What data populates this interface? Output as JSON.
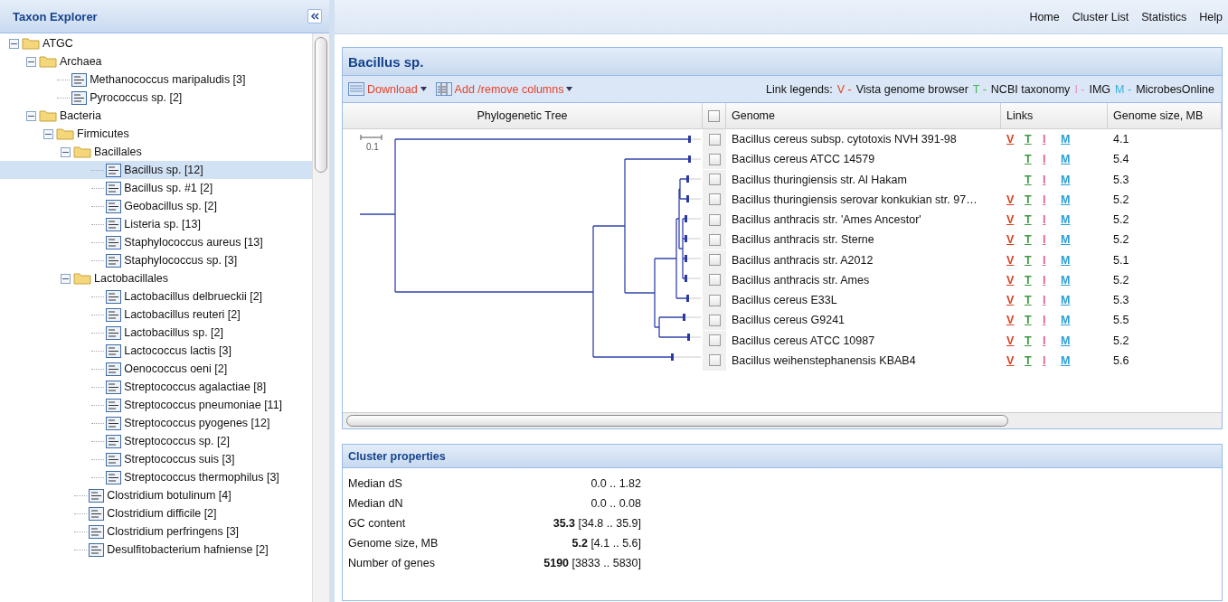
{
  "taxon_explorer": {
    "title": "Taxon Explorer",
    "tree": [
      {
        "kind": "folder",
        "label": "ATGC",
        "expanded": true,
        "selected": false,
        "children": [
          {
            "kind": "folder",
            "label": "Archaea",
            "expanded": true,
            "selected": false,
            "children": [
              {
                "kind": "leaf",
                "label": "Methanococcus maripaludis [3]",
                "selected": false
              },
              {
                "kind": "leaf",
                "label": "Pyrococcus sp. [2]",
                "selected": false
              }
            ]
          },
          {
            "kind": "folder",
            "label": "Bacteria",
            "expanded": true,
            "selected": false,
            "children": [
              {
                "kind": "folder",
                "label": "Firmicutes",
                "expanded": true,
                "selected": false,
                "children": [
                  {
                    "kind": "folder",
                    "label": "Bacillales",
                    "expanded": true,
                    "selected": false,
                    "children": [
                      {
                        "kind": "leaf",
                        "label": "Bacillus sp. [12]",
                        "selected": true
                      },
                      {
                        "kind": "leaf",
                        "label": "Bacillus sp. #1 [2]",
                        "selected": false
                      },
                      {
                        "kind": "leaf",
                        "label": "Geobacillus sp. [2]",
                        "selected": false
                      },
                      {
                        "kind": "leaf",
                        "label": "Listeria sp. [13]",
                        "selected": false
                      },
                      {
                        "kind": "leaf",
                        "label": "Staphylococcus aureus [13]",
                        "selected": false
                      },
                      {
                        "kind": "leaf",
                        "label": "Staphylococcus sp. [3]",
                        "selected": false
                      }
                    ]
                  },
                  {
                    "kind": "folder",
                    "label": "Lactobacillales",
                    "expanded": true,
                    "selected": false,
                    "children": [
                      {
                        "kind": "leaf",
                        "label": "Lactobacillus delbrueckii [2]",
                        "selected": false
                      },
                      {
                        "kind": "leaf",
                        "label": "Lactobacillus reuteri [2]",
                        "selected": false
                      },
                      {
                        "kind": "leaf",
                        "label": "Lactobacillus sp. [2]",
                        "selected": false
                      },
                      {
                        "kind": "leaf",
                        "label": "Lactococcus lactis [3]",
                        "selected": false
                      },
                      {
                        "kind": "leaf",
                        "label": "Oenococcus oeni [2]",
                        "selected": false
                      },
                      {
                        "kind": "leaf",
                        "label": "Streptococcus agalactiae [8]",
                        "selected": false
                      },
                      {
                        "kind": "leaf",
                        "label": "Streptococcus pneumoniae [11]",
                        "selected": false
                      },
                      {
                        "kind": "leaf",
                        "label": "Streptococcus pyogenes [12]",
                        "selected": false
                      },
                      {
                        "kind": "leaf",
                        "label": "Streptococcus sp. [2]",
                        "selected": false
                      },
                      {
                        "kind": "leaf",
                        "label": "Streptococcus suis [3]",
                        "selected": false
                      },
                      {
                        "kind": "leaf",
                        "label": "Streptococcus thermophilus [3]",
                        "selected": false
                      }
                    ]
                  },
                  {
                    "kind": "leaf",
                    "label": "Clostridium botulinum [4]",
                    "selected": false
                  },
                  {
                    "kind": "leaf",
                    "label": "Clostridium difficile [2]",
                    "selected": false
                  },
                  {
                    "kind": "leaf",
                    "label": "Clostridium perfringens [3]",
                    "selected": false
                  },
                  {
                    "kind": "leaf",
                    "label": "Desulfitobacterium hafniense [2]",
                    "selected": false
                  }
                ]
              }
            ]
          }
        ]
      }
    ]
  },
  "nav": [
    "Home",
    "Cluster List",
    "Statistics",
    "Help"
  ],
  "cluster": {
    "title": "Bacillus sp.",
    "toolbar": [
      {
        "kind": "download",
        "label": "Download"
      },
      {
        "kind": "columns",
        "label": "Add /remove columns"
      }
    ],
    "legend_label": "Link legends:",
    "legend": [
      {
        "label": "V -",
        "description": "Vista genome browser",
        "color": "#e0421e"
      },
      {
        "label": "T -",
        "description": "NCBI taxonomy",
        "color": "#45b653"
      },
      {
        "label": "I -",
        "description": "IMG",
        "color": "#e68fb8"
      },
      {
        "label": "M -",
        "description": "MicrobesOnline",
        "color": "#35b0dc"
      }
    ],
    "tree_column": "Phylogenetic Tree",
    "scale_label": "0.1",
    "header_checked": false,
    "columns": [
      "Genome",
      "Links",
      "Genome size, MB"
    ],
    "rows": [
      {
        "genome": "Bacillus cereus subsp. cytotoxis NVH 391-98",
        "checked": false,
        "size": "4.1",
        "links": [
          {
            "kind": "v",
            "label": "V",
            "color": "#d9401e"
          },
          {
            "kind": "t",
            "label": "T",
            "color": "#3a9a3f"
          },
          {
            "kind": "i",
            "label": "I",
            "color": "#e0609a"
          },
          {
            "kind": "m",
            "label": "M",
            "color": "#2a9fd6"
          }
        ]
      },
      {
        "genome": "Bacillus cereus ATCC 14579",
        "checked": false,
        "size": "5.4",
        "links": [
          {
            "kind": "t",
            "label": "T",
            "color": "#3a9a3f"
          },
          {
            "kind": "i",
            "label": "I",
            "color": "#e0609a"
          },
          {
            "kind": "m",
            "label": "M",
            "color": "#2a9fd6"
          }
        ]
      },
      {
        "genome": "Bacillus thuringiensis str. Al Hakam",
        "checked": false,
        "size": "5.3",
        "links": [
          {
            "kind": "t",
            "label": "T",
            "color": "#3a9a3f"
          },
          {
            "kind": "i",
            "label": "I",
            "color": "#e0609a"
          },
          {
            "kind": "m",
            "label": "M",
            "color": "#2a9fd6"
          }
        ]
      },
      {
        "genome": "Bacillus thuringiensis serovar konkukian str. 97…",
        "checked": false,
        "size": "5.2",
        "links": [
          {
            "kind": "v",
            "label": "V",
            "color": "#d9401e"
          },
          {
            "kind": "t",
            "label": "T",
            "color": "#3a9a3f"
          },
          {
            "kind": "i",
            "label": "I",
            "color": "#e0609a"
          },
          {
            "kind": "m",
            "label": "M",
            "color": "#2a9fd6"
          }
        ]
      },
      {
        "genome": "Bacillus anthracis str. 'Ames Ancestor'",
        "checked": false,
        "size": "5.2",
        "links": [
          {
            "kind": "v",
            "label": "V",
            "color": "#d9401e"
          },
          {
            "kind": "t",
            "label": "T",
            "color": "#3a9a3f"
          },
          {
            "kind": "i",
            "label": "I",
            "color": "#e0609a"
          },
          {
            "kind": "m",
            "label": "M",
            "color": "#2a9fd6"
          }
        ]
      },
      {
        "genome": "Bacillus anthracis str. Sterne",
        "checked": false,
        "size": "5.2",
        "links": [
          {
            "kind": "v",
            "label": "V",
            "color": "#d9401e"
          },
          {
            "kind": "t",
            "label": "T",
            "color": "#3a9a3f"
          },
          {
            "kind": "i",
            "label": "I",
            "color": "#e0609a"
          },
          {
            "kind": "m",
            "label": "M",
            "color": "#2a9fd6"
          }
        ]
      },
      {
        "genome": "Bacillus anthracis str. A2012",
        "checked": false,
        "size": "5.1",
        "links": [
          {
            "kind": "v",
            "label": "V",
            "color": "#d9401e"
          },
          {
            "kind": "t",
            "label": "T",
            "color": "#3a9a3f"
          },
          {
            "kind": "i",
            "label": "I",
            "color": "#e0609a"
          },
          {
            "kind": "m",
            "label": "M",
            "color": "#2a9fd6"
          }
        ]
      },
      {
        "genome": "Bacillus anthracis str. Ames",
        "checked": false,
        "size": "5.2",
        "links": [
          {
            "kind": "v",
            "label": "V",
            "color": "#d9401e"
          },
          {
            "kind": "t",
            "label": "T",
            "color": "#3a9a3f"
          },
          {
            "kind": "i",
            "label": "I",
            "color": "#e0609a"
          },
          {
            "kind": "m",
            "label": "M",
            "color": "#2a9fd6"
          }
        ]
      },
      {
        "genome": "Bacillus cereus E33L",
        "checked": false,
        "size": "5.3",
        "links": [
          {
            "kind": "v",
            "label": "V",
            "color": "#d9401e"
          },
          {
            "kind": "t",
            "label": "T",
            "color": "#3a9a3f"
          },
          {
            "kind": "i",
            "label": "I",
            "color": "#e0609a"
          },
          {
            "kind": "m",
            "label": "M",
            "color": "#2a9fd6"
          }
        ]
      },
      {
        "genome": "Bacillus cereus G9241",
        "checked": false,
        "size": "5.5",
        "links": [
          {
            "kind": "v",
            "label": "V",
            "color": "#d9401e"
          },
          {
            "kind": "t",
            "label": "T",
            "color": "#3a9a3f"
          },
          {
            "kind": "i",
            "label": "I",
            "color": "#e0609a"
          },
          {
            "kind": "m",
            "label": "M",
            "color": "#2a9fd6"
          }
        ]
      },
      {
        "genome": "Bacillus cereus ATCC 10987",
        "checked": false,
        "size": "5.2",
        "links": [
          {
            "kind": "v",
            "label": "V",
            "color": "#d9401e"
          },
          {
            "kind": "t",
            "label": "T",
            "color": "#3a9a3f"
          },
          {
            "kind": "i",
            "label": "I",
            "color": "#e0609a"
          },
          {
            "kind": "m",
            "label": "M",
            "color": "#2a9fd6"
          }
        ]
      },
      {
        "genome": "Bacillus weihenstephanensis KBAB4",
        "checked": false,
        "size": "5.6",
        "links": [
          {
            "kind": "v",
            "label": "V",
            "color": "#d9401e"
          },
          {
            "kind": "t",
            "label": "T",
            "color": "#3a9a3f"
          },
          {
            "kind": "i",
            "label": "I",
            "color": "#e0609a"
          },
          {
            "kind": "m",
            "label": "M",
            "color": "#2a9fd6"
          }
        ]
      }
    ]
  },
  "properties": {
    "title": "Cluster properties",
    "rows": [
      {
        "label": "Median dS",
        "value": "0.0 .. 1.82"
      },
      {
        "label": "Median dN",
        "value": "0.0 .. 0.08"
      },
      {
        "label": "GC content",
        "value": "**35.3** [34.8 .. 35.9]"
      },
      {
        "label": "Genome size, MB",
        "value": "**5.2** [4.1 .. 5.6]"
      },
      {
        "label": "Number of genes",
        "value": "**5190** [3833 .. 5830]"
      }
    ]
  }
}
